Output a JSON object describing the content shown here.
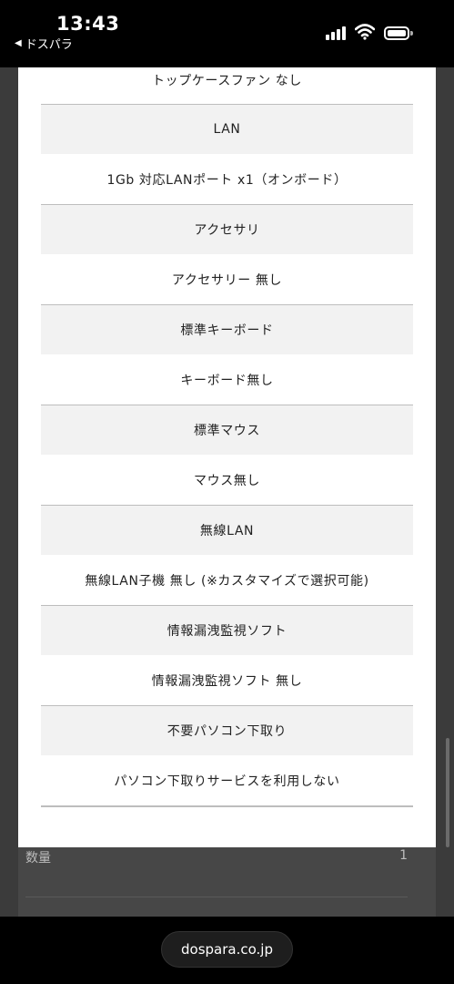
{
  "status_bar": {
    "time": "13:43",
    "back_app": "ドスパラ"
  },
  "spec_top_value": "トップケースファン なし",
  "spec_groups": [
    {
      "heading": "LAN",
      "value": "1Gb 対応LANポート x1（オンボード）"
    },
    {
      "heading": "アクセサリ",
      "value": "アクセサリー 無し"
    },
    {
      "heading": "標準キーボード",
      "value": "キーボード無し"
    },
    {
      "heading": "標準マウス",
      "value": "マウス無し"
    },
    {
      "heading": "無線LAN",
      "value": "無線LAN子機 無し (※カスタマイズで選択可能)"
    },
    {
      "heading": "情報漏洩監視ソフト",
      "value": "情報漏洩監視ソフト 無し"
    },
    {
      "heading": "不要パソコン下取り",
      "value": "パソコン下取りサービスを利用しない"
    }
  ],
  "background": {
    "quantity_label": "数量",
    "quantity_value": "1"
  },
  "browser": {
    "url": "dospara.co.jp"
  }
}
